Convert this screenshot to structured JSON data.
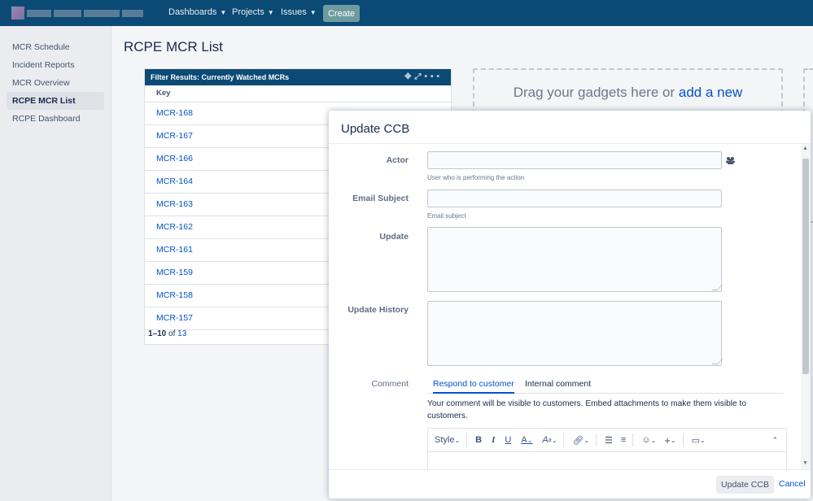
{
  "nav": {
    "items": [
      {
        "label": "Dashboards"
      },
      {
        "label": "Projects"
      },
      {
        "label": "Issues"
      }
    ],
    "create_label": "Create"
  },
  "sidebar": {
    "items": [
      {
        "label": "MCR Schedule"
      },
      {
        "label": "Incident Reports"
      },
      {
        "label": "MCR Overview"
      },
      {
        "label": "RCPE MCR List",
        "active": true
      },
      {
        "label": "RCPE Dashboard"
      }
    ]
  },
  "page": {
    "title": "RCPE MCR List"
  },
  "gadget": {
    "header": "Filter Results: Currently Watched MCRs",
    "column": "Key",
    "rows": [
      "MCR-168",
      "MCR-167",
      "MCR-166",
      "MCR-164",
      "MCR-163",
      "MCR-162",
      "MCR-161",
      "MCR-159",
      "MCR-158",
      "MCR-157"
    ],
    "pager_range": "1–10",
    "pager_of": "of",
    "pager_total": "13"
  },
  "dropzone": {
    "text": "Drag your gadgets here or ",
    "link": "add a new"
  },
  "modal": {
    "title": "Update CCB",
    "actor_label": "Actor",
    "actor_help": "User who is performing the action",
    "email_label": "Email Subject",
    "email_help": "Email subject",
    "update_label": "Update",
    "history_label": "Update History",
    "comment_label": "Comment",
    "tab_customer": "Respond to customer",
    "tab_internal": "Internal comment",
    "comment_note": "Your comment will be visible to customers. Embed attachments to make them visible to customers.",
    "toolbar_style": "Style",
    "submit_label": "Update CCB",
    "cancel_label": "Cancel"
  }
}
